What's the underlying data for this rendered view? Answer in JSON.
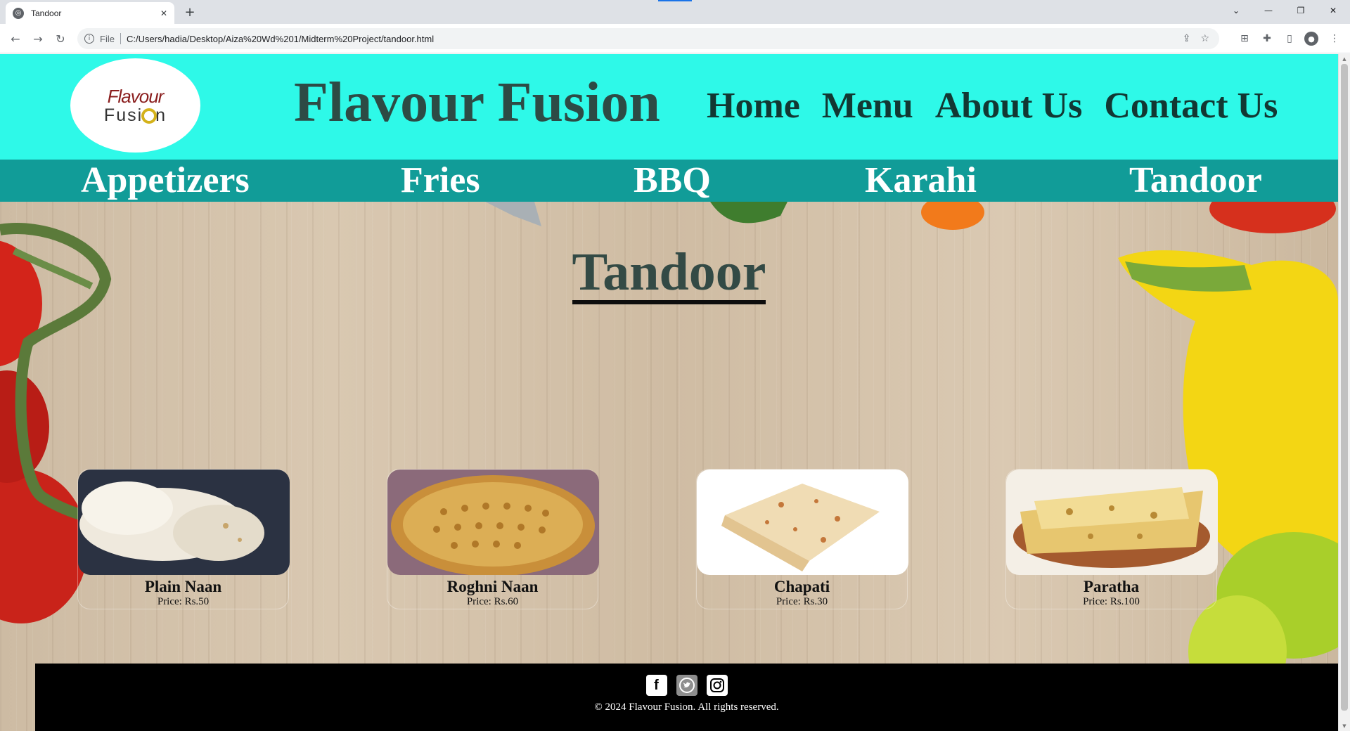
{
  "browser": {
    "tab_title": "Tandoor",
    "scheme": "File",
    "url": "C:/Users/hadia/Desktop/Aiza%20Wd%201/Midterm%20Project/tandoor.html",
    "icons": [
      "back-icon",
      "forward-icon",
      "reload-icon",
      "info-icon",
      "share-icon",
      "star-icon",
      "extensions-icon",
      "puzzle-icon",
      "sidepanel-icon",
      "profile-icon",
      "menu-icon"
    ],
    "window_controls": [
      "chevron-down-icon",
      "minimize-icon",
      "restore-icon",
      "close-icon"
    ]
  },
  "header": {
    "logo_line1": "Flavour",
    "logo_line2a": "Fusi",
    "logo_line2b": "n",
    "brand": "Flavour Fusion",
    "nav": [
      "Home",
      "Menu",
      "About Us",
      "Contact Us"
    ]
  },
  "categories": [
    "Appetizers",
    "Fries",
    "BBQ",
    "Karahi",
    "Tandoor"
  ],
  "page_title": "Tandoor",
  "items": [
    {
      "name": "Plain Naan",
      "price": "Price: Rs.50"
    },
    {
      "name": "Roghni Naan",
      "price": "Price: Rs.60"
    },
    {
      "name": "Chapati",
      "price": "Price: Rs.30"
    },
    {
      "name": "Paratha",
      "price": "Price: Rs.100"
    }
  ],
  "footer": {
    "social": [
      "facebook-icon",
      "twitter-icon",
      "instagram-icon"
    ],
    "copyright": "© 2024 Flavour Fusion. All rights reserved."
  },
  "colors": {
    "header_bg": "#2ef9e8",
    "category_bg": "#119c98",
    "brand_text": "#2d4b45",
    "footer_bg": "#000000"
  }
}
